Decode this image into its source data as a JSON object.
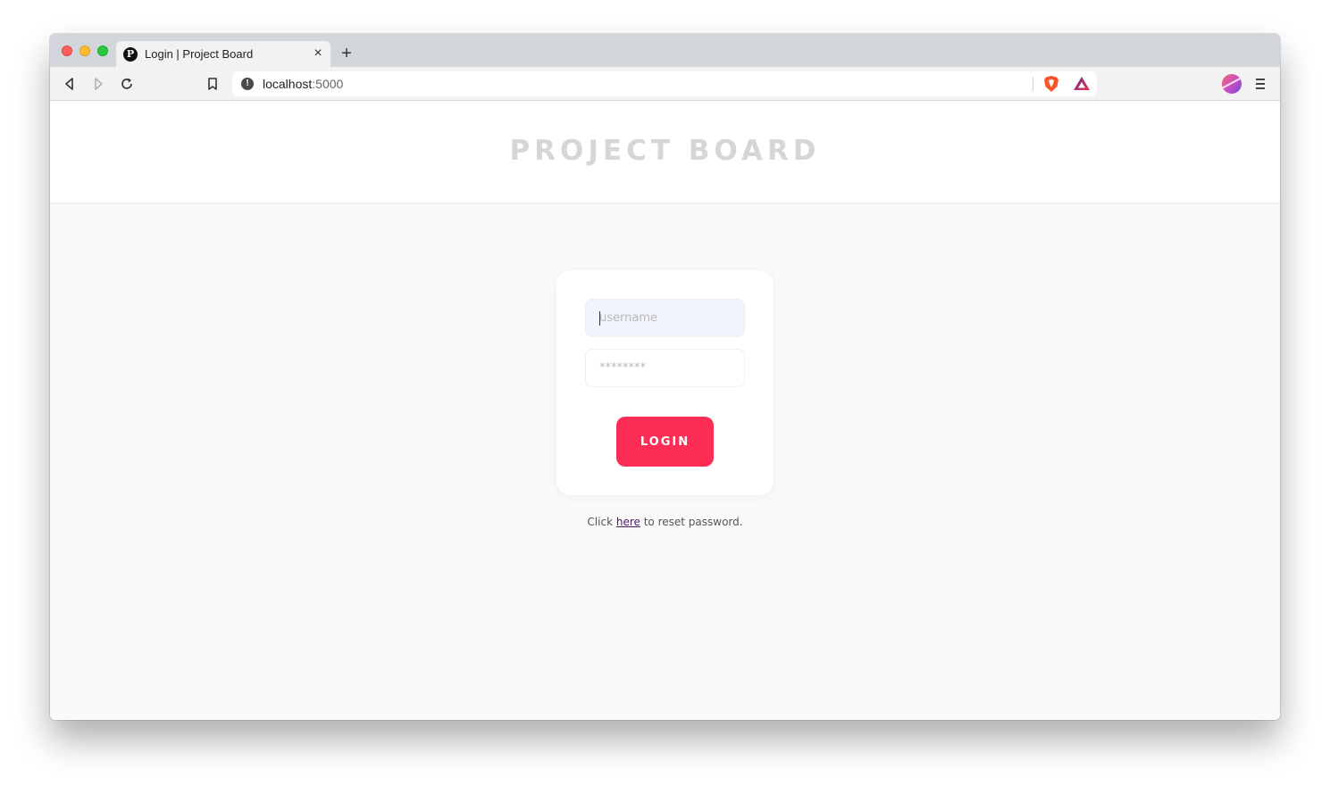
{
  "browser": {
    "tab": {
      "favicon_letter": "P",
      "title": "Login | Project Board",
      "close_glyph": "×"
    },
    "new_tab_glyph": "+",
    "address_bar": {
      "host": "localhost",
      "port": ":5000"
    },
    "icons": {
      "back": "back-arrow-icon",
      "forward": "forward-arrow-icon",
      "reload": "reload-icon",
      "bookmark": "bookmark-icon",
      "site_info": "info-icon",
      "shields": "brave-shield-icon",
      "rewards": "brave-rewards-icon",
      "profile": "profile-avatar",
      "menu": "hamburger-menu-icon"
    },
    "colors": {
      "traffic_red": "#fe5f57",
      "traffic_yellow": "#febc2e",
      "traffic_green": "#28c840"
    }
  },
  "header": {
    "title": "PROJECT BOARD"
  },
  "login": {
    "username_placeholder": "username",
    "password_placeholder": "********",
    "button_label": "LOGIN"
  },
  "reset": {
    "prefix": "Click ",
    "link_text": "here",
    "suffix": " to reset password."
  },
  "colors": {
    "accent": "#fe2d55",
    "title_text": "#d6d6d6",
    "link": "#4b1a6e"
  }
}
